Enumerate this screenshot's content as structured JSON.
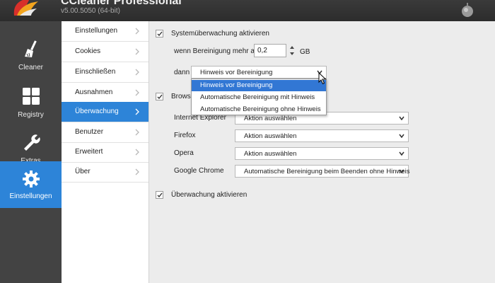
{
  "app": {
    "title": "CCleaner Professional",
    "version": "v5.00.5050 (64-bit)"
  },
  "colors": {
    "accent": "#2d84d8",
    "sidebar_bg": "#434343",
    "titlebar_bg": "#2f2f2f",
    "content_bg": "#ececec"
  },
  "sidebar": {
    "items": [
      {
        "label": "Cleaner",
        "icon": "broom-icon",
        "active": false
      },
      {
        "label": "Registry",
        "icon": "registry-grid-icon",
        "active": false
      },
      {
        "label": "Extras",
        "icon": "wrench-icon",
        "active": false
      },
      {
        "label": "Einstellungen",
        "icon": "gear-icon",
        "active": true
      }
    ]
  },
  "subnav": {
    "items": [
      {
        "label": "Einstellungen",
        "active": false
      },
      {
        "label": "Cookies",
        "active": false
      },
      {
        "label": "Einschließen",
        "active": false
      },
      {
        "label": "Ausnahmen",
        "active": false
      },
      {
        "label": "Überwachung",
        "active": true
      },
      {
        "label": "Benutzer",
        "active": false
      },
      {
        "label": "Erweitert",
        "active": false
      },
      {
        "label": "Über",
        "active": false
      }
    ]
  },
  "monitoring": {
    "system_checkbox_label": "Systemüberwachung aktivieren",
    "system_checked": true,
    "threshold_label": "wenn Bereinigung mehr als",
    "threshold_value": "0,2",
    "threshold_unit": "GB",
    "then_label": "dann",
    "then_select_value": "Hinweis vor Bereinigung",
    "then_options": [
      "Hinweis vor Bereinigung",
      "Automatische Bereinigung mit Hinweis",
      "Automatische Bereinigung ohne Hinweis"
    ],
    "then_highlighted_index": 0,
    "browser_checkbox_label": "Browse",
    "browser_checked": true,
    "browsers": [
      {
        "name": "Internet Explorer",
        "action": "Aktion auswählen"
      },
      {
        "name": "Firefox",
        "action": "Aktion auswählen"
      },
      {
        "name": "Opera",
        "action": "Aktion auswählen"
      },
      {
        "name": "Google Chrome",
        "action": "Automatische Bereinigung beim Beenden ohne Hinweis"
      }
    ],
    "enable_checkbox_label": "Überwachung aktivieren",
    "enable_checked": true
  }
}
